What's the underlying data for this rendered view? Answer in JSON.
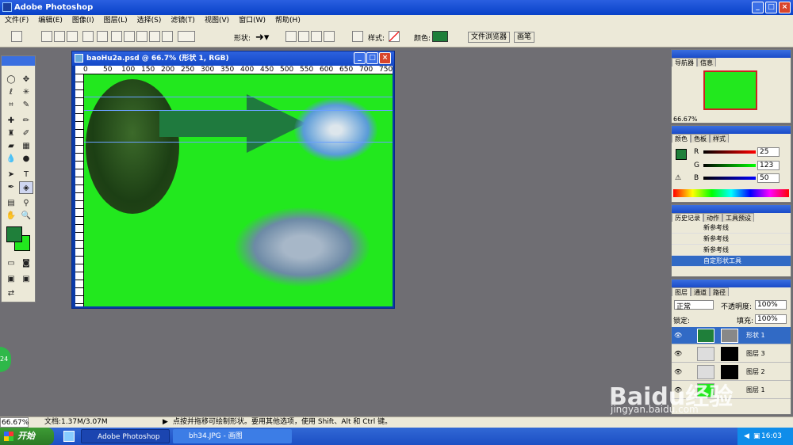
{
  "app": {
    "title": "Adobe Photoshop"
  },
  "menu": [
    "文件(F)",
    "编辑(E)",
    "图像(I)",
    "图层(L)",
    "选择(S)",
    "滤镜(T)",
    "视图(V)",
    "窗口(W)",
    "帮助(H)"
  ],
  "options": {
    "shape_label": "形状:",
    "style_label": "样式:",
    "color_label": "颜色:",
    "color": "#1f7f3a",
    "tab_file_browser": "文件浏览器",
    "tab_brushes": "画笔"
  },
  "document": {
    "title": "baoHu2a.psd @ 66.7% (形状 1, RGB)",
    "ruler_marks": [
      "0",
      "50",
      "100",
      "150",
      "200",
      "250",
      "300",
      "350",
      "400",
      "450",
      "500",
      "550",
      "600",
      "650",
      "700",
      "750"
    ],
    "canvas_color": "#22e81e",
    "arrow_color": "#1f7a3e"
  },
  "navigator": {
    "tabs": [
      "导航器",
      "信息"
    ],
    "zoom": "66.67%"
  },
  "color_panel": {
    "tabs": [
      "颜色",
      "色板",
      "样式"
    ],
    "r_label": "R",
    "g_label": "G",
    "b_label": "B",
    "r": "25",
    "g": "123",
    "b": "50"
  },
  "history": {
    "tabs": [
      "历史记录",
      "动作",
      "工具预设"
    ],
    "items": [
      "新参考线",
      "新参考线",
      "新参考线",
      "自定形状工具"
    ]
  },
  "layers": {
    "tabs": [
      "图层",
      "通道",
      "路径"
    ],
    "blend": "正常",
    "opacity_label": "不透明度:",
    "opacity": "100%",
    "lock_label": "锁定:",
    "fill_label": "填充:",
    "fill": "100%",
    "items": [
      "形状 1",
      "图层 3",
      "图层 2",
      "图层 1"
    ]
  },
  "status": {
    "zoom": "66.67%",
    "doc": "文档:1.37M/3.07M",
    "hint": "点按并拖移可绘制形状。要用其他选项，使用 Shift、Alt 和 Ctrl 键。"
  },
  "taskbar": {
    "start": "开始",
    "tasks": [
      "Adobe Photoshop",
      "bh34.JPG - 画图"
    ],
    "time": "16:03"
  },
  "watermark": {
    "text": "Baidu经验",
    "sub": "jingyan.baidu.com"
  },
  "side_badge": "24"
}
